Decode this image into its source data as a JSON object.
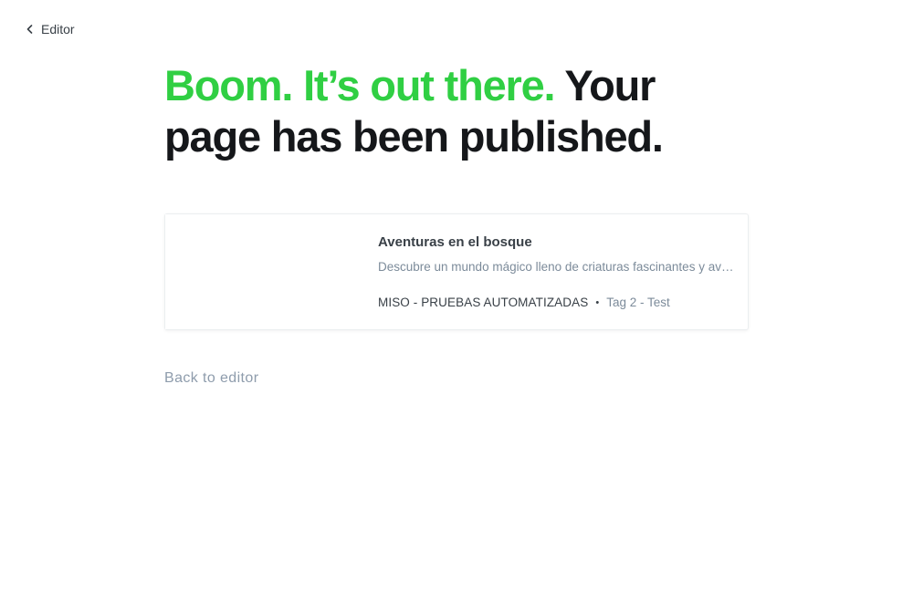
{
  "nav": {
    "back_label": "Editor",
    "back_icon": "chevron-left-icon"
  },
  "headline": {
    "accent": "Boom. It’s out there.",
    "rest": " Your page has been published.",
    "accent_color": "#30cf43"
  },
  "card": {
    "title": "Aventuras en el bosque",
    "excerpt": "Descubre un mundo mágico lleno de criaturas fascinantes y aventuras inolvidables",
    "site_name": "MISO - PRUEBAS AUTOMATIZADAS",
    "separator": "•",
    "tags": "Tag 2 - Test"
  },
  "footer": {
    "back_to_editor": "Back to editor"
  }
}
